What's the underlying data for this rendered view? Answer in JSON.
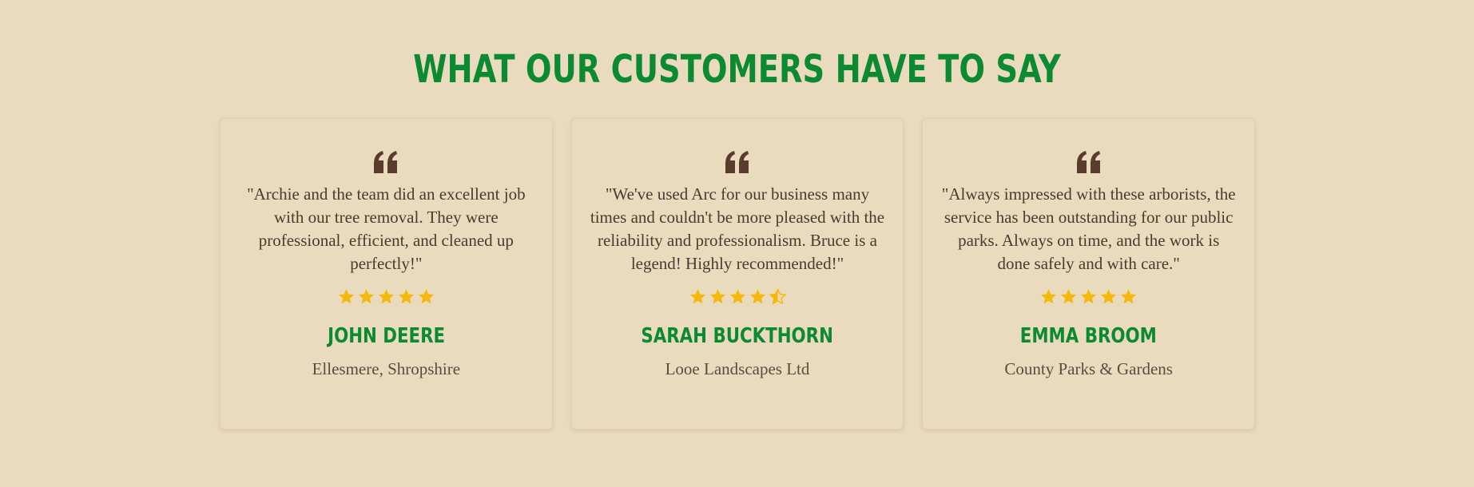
{
  "section": {
    "title": "What our customers have to say"
  },
  "colors": {
    "background": "#eadabe",
    "accent_green": "#0b8a32",
    "star_gold": "#f5b90c",
    "quote_brown": "#5a3c2e"
  },
  "testimonials": [
    {
      "icon": "quote-icon",
      "quote": "\"Archie and the team did an excellent job with our tree removal. They were professional, efficient, and cleaned up perfectly!\"",
      "rating": 5,
      "name": "John Deere",
      "location": "Ellesmere, Shropshire"
    },
    {
      "icon": "quote-icon",
      "quote": "\"We've used Arc for our business many times and couldn't be more pleased with the reliability and professionalism. Bruce is a legend! Highly recommended!\"",
      "rating": 4.5,
      "name": "Sarah Buckthorn",
      "location": "Looe Landscapes Ltd"
    },
    {
      "icon": "quote-icon",
      "quote": "\"Always impressed with these arborists, the service has been outstanding for our public parks. Always on time, and the work is done safely and with care.\"",
      "rating": 5,
      "name": "Emma Broom",
      "location": "County Parks & Gardens"
    }
  ]
}
